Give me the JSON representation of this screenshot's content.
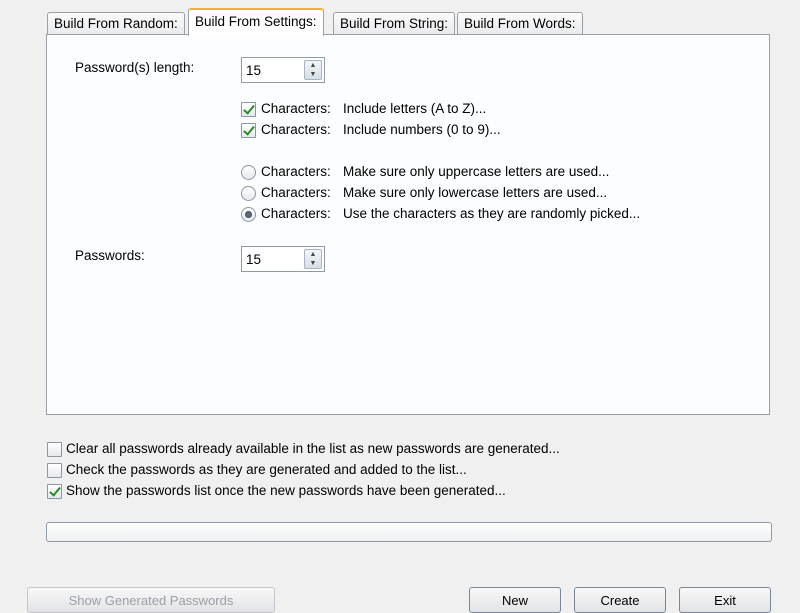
{
  "tabs": [
    {
      "label": "Build From Random:"
    },
    {
      "label": "Build From Settings:"
    },
    {
      "label": "Build From String:"
    },
    {
      "label": "Build From Words:"
    }
  ],
  "settings": {
    "length_label": "Password(s) length:",
    "length_value": "15",
    "include_letters": {
      "prefix": "Characters:",
      "text": "Include letters (A to Z)...",
      "checked": true
    },
    "include_numbers": {
      "prefix": "Characters:",
      "text": "Include numbers (0 to 9)...",
      "checked": true
    },
    "case_options": [
      {
        "prefix": "Characters:",
        "text": "Make sure only uppercase letters are used...",
        "selected": false
      },
      {
        "prefix": "Characters:",
        "text": "Make sure only lowercase letters are used...",
        "selected": false
      },
      {
        "prefix": "Characters:",
        "text": "Use the characters as they are randomly picked...",
        "selected": true
      }
    ],
    "count_label": "Passwords:",
    "count_value": "15"
  },
  "options": [
    {
      "text": "Clear all passwords already available in the list as new passwords are generated...",
      "checked": false
    },
    {
      "text": "Check the passwords as they are generated and added to the list...",
      "checked": false
    },
    {
      "text": "Show the passwords list once the new passwords have been generated...",
      "checked": true
    }
  ],
  "progress": {
    "value": 0
  },
  "buttons": {
    "show_generated": "Show Generated Passwords",
    "new": "New",
    "create": "Create",
    "exit": "Exit"
  },
  "colors": {
    "active_tab_accent": "#f4b23c",
    "panel_background": "#fbfdff",
    "check_mark": "#2a8a2a"
  }
}
